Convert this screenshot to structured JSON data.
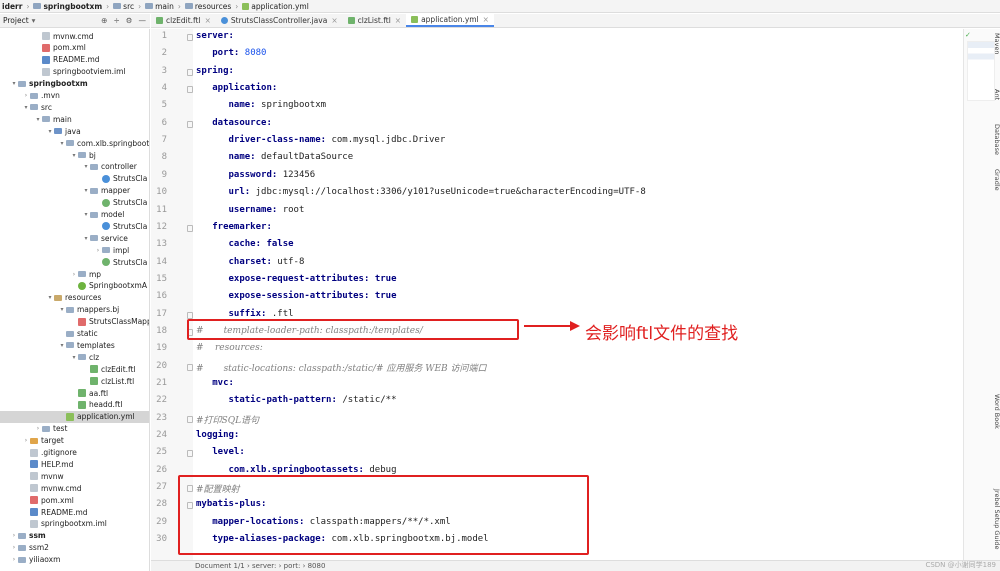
{
  "breadcrumb": [
    "iderr",
    "springbootxm",
    "src",
    "main",
    "resources",
    "application.yml"
  ],
  "project_panel": {
    "title": "Project",
    "tool_icons": [
      "⊕",
      "÷",
      "⚙",
      "—"
    ]
  },
  "tabs": [
    {
      "label": "clzEdit.ftl",
      "active": false
    },
    {
      "label": "StrutsClassController.java",
      "active": false
    },
    {
      "label": "clzList.ftl",
      "active": false
    },
    {
      "label": "application.yml",
      "active": true
    }
  ],
  "tree": [
    {
      "label": "mvnw.cmd",
      "indent": 3,
      "icon": "file",
      "arrow": ""
    },
    {
      "label": "pom.xml",
      "indent": 3,
      "icon": "xml",
      "arrow": ""
    },
    {
      "label": "README.md",
      "indent": 3,
      "icon": "md",
      "arrow": ""
    },
    {
      "label": "springbootviem.iml",
      "indent": 3,
      "icon": "file",
      "arrow": ""
    },
    {
      "label": "springbootxm",
      "indent": 1,
      "icon": "folder",
      "arrow": "▾",
      "bold": true
    },
    {
      "label": ".mvn",
      "indent": 2,
      "icon": "folder",
      "arrow": "›"
    },
    {
      "label": "src",
      "indent": 2,
      "icon": "folder",
      "arrow": "▾"
    },
    {
      "label": "main",
      "indent": 3,
      "icon": "folder",
      "arrow": "▾"
    },
    {
      "label": "java",
      "indent": 4,
      "icon": "folder-src",
      "arrow": "▾"
    },
    {
      "label": "com.xlb.springboot",
      "indent": 5,
      "icon": "folder",
      "arrow": "▾"
    },
    {
      "label": "bj",
      "indent": 6,
      "icon": "folder",
      "arrow": "▾"
    },
    {
      "label": "controller",
      "indent": 7,
      "icon": "folder",
      "arrow": "▾"
    },
    {
      "label": "StrutsCla",
      "indent": 8,
      "icon": "class",
      "arrow": ""
    },
    {
      "label": "mapper",
      "indent": 7,
      "icon": "folder",
      "arrow": "▾"
    },
    {
      "label": "StrutsCla",
      "indent": 8,
      "icon": "iface",
      "arrow": ""
    },
    {
      "label": "model",
      "indent": 7,
      "icon": "folder",
      "arrow": "▾"
    },
    {
      "label": "StrutsCla",
      "indent": 8,
      "icon": "class",
      "arrow": ""
    },
    {
      "label": "service",
      "indent": 7,
      "icon": "folder",
      "arrow": "▾"
    },
    {
      "label": "impl",
      "indent": 8,
      "icon": "folder",
      "arrow": "›"
    },
    {
      "label": "StrutsCla",
      "indent": 8,
      "icon": "iface",
      "arrow": ""
    },
    {
      "label": "mp",
      "indent": 6,
      "icon": "folder",
      "arrow": "›"
    },
    {
      "label": "SpringbootxmA",
      "indent": 6,
      "icon": "spring",
      "arrow": ""
    },
    {
      "label": "resources",
      "indent": 4,
      "icon": "folder-res",
      "arrow": "▾"
    },
    {
      "label": "mappers.bj",
      "indent": 5,
      "icon": "folder",
      "arrow": "▾"
    },
    {
      "label": "StrutsClassMapp",
      "indent": 6,
      "icon": "xml",
      "arrow": ""
    },
    {
      "label": "static",
      "indent": 5,
      "icon": "folder",
      "arrow": ""
    },
    {
      "label": "templates",
      "indent": 5,
      "icon": "folder",
      "arrow": "▾"
    },
    {
      "label": "clz",
      "indent": 6,
      "icon": "folder",
      "arrow": "▾"
    },
    {
      "label": "clzEdit.ftl",
      "indent": 7,
      "icon": "ftl",
      "arrow": ""
    },
    {
      "label": "clzList.ftl",
      "indent": 7,
      "icon": "ftl",
      "arrow": ""
    },
    {
      "label": "aa.ftl",
      "indent": 6,
      "icon": "ftl",
      "arrow": ""
    },
    {
      "label": "headd.ftl",
      "indent": 6,
      "icon": "ftl",
      "arrow": ""
    },
    {
      "label": "application.yml",
      "indent": 5,
      "icon": "yml",
      "arrow": "",
      "selected": true
    },
    {
      "label": "test",
      "indent": 3,
      "icon": "folder",
      "arrow": "›"
    },
    {
      "label": "target",
      "indent": 2,
      "icon": "folder-target",
      "arrow": "›"
    },
    {
      "label": ".gitignore",
      "indent": 2,
      "icon": "file",
      "arrow": ""
    },
    {
      "label": "HELP.md",
      "indent": 2,
      "icon": "md",
      "arrow": ""
    },
    {
      "label": "mvnw",
      "indent": 2,
      "icon": "file",
      "arrow": ""
    },
    {
      "label": "mvnw.cmd",
      "indent": 2,
      "icon": "file",
      "arrow": ""
    },
    {
      "label": "pom.xml",
      "indent": 2,
      "icon": "xml",
      "arrow": ""
    },
    {
      "label": "README.md",
      "indent": 2,
      "icon": "md",
      "arrow": ""
    },
    {
      "label": "springbootxm.iml",
      "indent": 2,
      "icon": "file",
      "arrow": ""
    },
    {
      "label": "ssm",
      "indent": 1,
      "icon": "folder",
      "arrow": "›",
      "bold": true
    },
    {
      "label": "ssm2",
      "indent": 1,
      "icon": "folder",
      "arrow": "›"
    },
    {
      "label": "yiliaoxm",
      "indent": 1,
      "icon": "folder",
      "arrow": "›"
    }
  ],
  "code_lines": [
    [
      {
        "t": "server:",
        "c": "key"
      }
    ],
    [
      {
        "t": "   port: ",
        "c": "key"
      },
      {
        "t": "8080",
        "c": "num"
      }
    ],
    [
      {
        "t": "spring:",
        "c": "key"
      }
    ],
    [
      {
        "t": "   application:",
        "c": "key"
      }
    ],
    [
      {
        "t": "      name: ",
        "c": "key"
      },
      {
        "t": "springbootxm",
        "c": "val"
      }
    ],
    [
      {
        "t": "   datasource:",
        "c": "key"
      }
    ],
    [
      {
        "t": "      driver-class-name: ",
        "c": "key"
      },
      {
        "t": "com.mysql.jdbc.Driver",
        "c": "val"
      }
    ],
    [
      {
        "t": "      name: ",
        "c": "key"
      },
      {
        "t": "defaultDataSource",
        "c": "val"
      }
    ],
    [
      {
        "t": "      password: ",
        "c": "key"
      },
      {
        "t": "123456",
        "c": "val"
      }
    ],
    [
      {
        "t": "      url: ",
        "c": "key"
      },
      {
        "t": "jdbc:mysql://localhost:3306/y101?useUnicode=true&characterEncoding=UTF-8",
        "c": "val"
      }
    ],
    [
      {
        "t": "      username: ",
        "c": "key"
      },
      {
        "t": "root",
        "c": "val"
      }
    ],
    [
      {
        "t": "   freemarker:",
        "c": "key"
      }
    ],
    [
      {
        "t": "      cache: ",
        "c": "key"
      },
      {
        "t": "false",
        "c": "kw"
      }
    ],
    [
      {
        "t": "      charset: ",
        "c": "key"
      },
      {
        "t": "utf-8",
        "c": "val"
      }
    ],
    [
      {
        "t": "      expose-request-attributes: ",
        "c": "key"
      },
      {
        "t": "true",
        "c": "kw"
      }
    ],
    [
      {
        "t": "      expose-session-attributes: ",
        "c": "key"
      },
      {
        "t": "true",
        "c": "kw"
      }
    ],
    [
      {
        "t": "      suffix: ",
        "c": "key"
      },
      {
        "t": ".ftl",
        "c": "val"
      }
    ],
    [
      {
        "t": "#       template-loader-path: classpath:/templates/",
        "c": "cmt"
      }
    ],
    [
      {
        "t": "#    resources:",
        "c": "cmt"
      }
    ],
    [
      {
        "t": "#       static-locations: classpath:/static/# 应用服务 WEB 访问端口",
        "c": "cmt"
      }
    ],
    [
      {
        "t": "   mvc:",
        "c": "key"
      }
    ],
    [
      {
        "t": "      static-path-pattern: ",
        "c": "key"
      },
      {
        "t": "/static/**",
        "c": "val"
      }
    ],
    [
      {
        "t": "#打印SQL语句",
        "c": "cmt"
      }
    ],
    [
      {
        "t": "logging:",
        "c": "key"
      }
    ],
    [
      {
        "t": "   level:",
        "c": "key"
      }
    ],
    [
      {
        "t": "      com.xlb.springbootassets: ",
        "c": "key"
      },
      {
        "t": "debug",
        "c": "val"
      }
    ],
    [
      {
        "t": "#配置映射",
        "c": "cmt"
      }
    ],
    [
      {
        "t": "mybatis-plus:",
        "c": "key"
      }
    ],
    [
      {
        "t": "   mapper-locations: ",
        "c": "key"
      },
      {
        "t": "classpath:mappers/**/*.xml",
        "c": "val"
      }
    ],
    [
      {
        "t": "   type-aliases-package: ",
        "c": "key"
      },
      {
        "t": "com.xlb.springbootxm.bj.model",
        "c": "val"
      }
    ]
  ],
  "annotation": "会影响ftl文件的查找",
  "right_tools": [
    "Maven",
    "Ant",
    "Database",
    "Gradle",
    "Word Book",
    "Jrebel Setup Guide"
  ],
  "status": {
    "path": "Document 1/1  ›  server:  ›  port:  ›  8080"
  },
  "watermark": "CSDN @小谢同学189",
  "colors": {
    "annotation": "#e02020",
    "key": "#000080",
    "number": "#1750eb",
    "comment": "#808080"
  }
}
